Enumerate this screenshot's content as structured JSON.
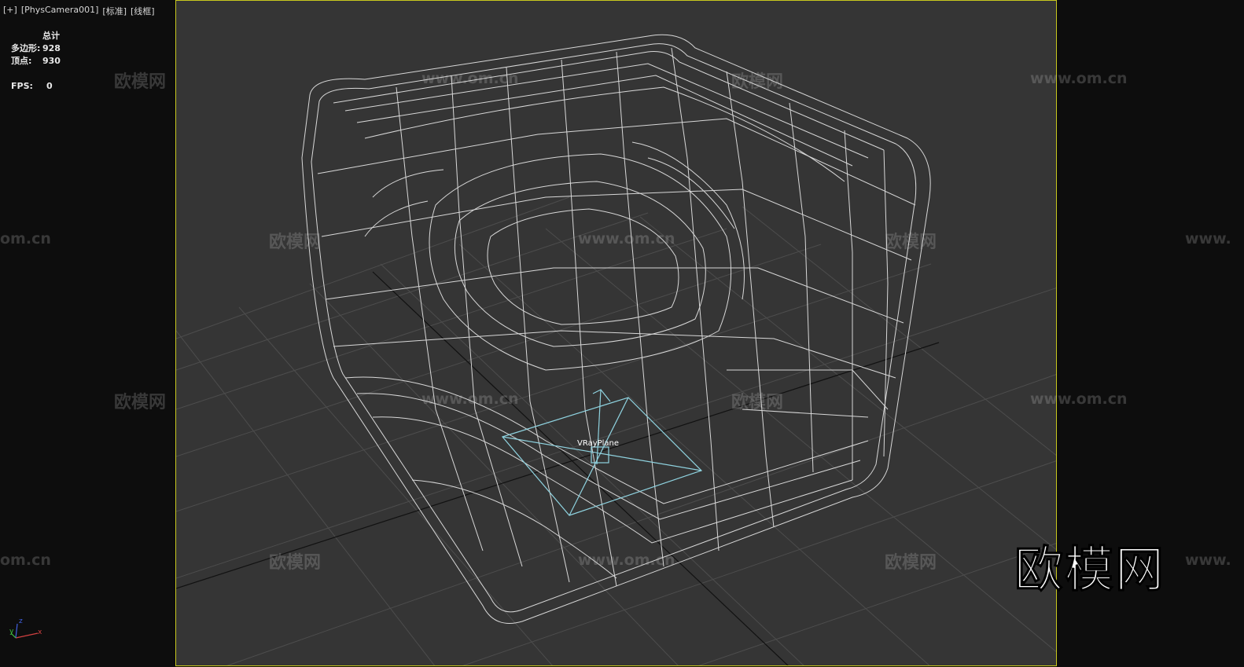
{
  "viewport": {
    "menu": "[+]",
    "camera": "[PhysCamera001]",
    "shading": "[标准]",
    "mode": "[线框]"
  },
  "stats": {
    "header": "总计",
    "polygons_label": "多边形:",
    "polygons_value": "928",
    "vertices_label": "顶点:",
    "vertices_value": "930",
    "fps_label": "FPS:",
    "fps_value": "0"
  },
  "scene": {
    "object_label": "VRayPlane",
    "wireframe_color": "#e6e6e6",
    "helper_color": "#8fd3e0",
    "frame_border_color": "#c8c81e"
  },
  "axis_gizmo": {
    "x": "x",
    "y": "y",
    "z": "z"
  },
  "watermarks": {
    "brand": "欧模网",
    "site": "www.om.cn",
    "site_short": "om.cn",
    "site_partial": "www."
  },
  "logo": "欧模网"
}
